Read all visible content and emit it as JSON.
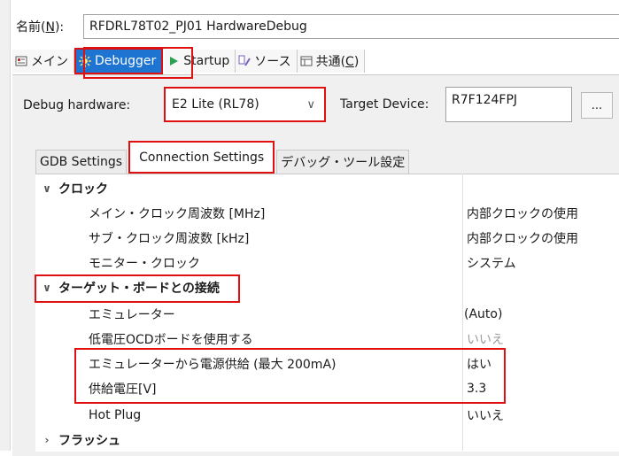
{
  "name_label": "名前(",
  "name_mnemonic": "N",
  "name_label_end": "):",
  "config_name": "RFDRL78T02_PJ01 HardwareDebug",
  "tabs": [
    {
      "label": "メイン",
      "icon": "main-icon"
    },
    {
      "label": "Debugger",
      "icon": "debugger-icon"
    },
    {
      "label": "Startup",
      "icon": "startup-icon"
    },
    {
      "label": "ソース",
      "icon": "source-icon"
    },
    {
      "label": "共通(",
      "mnemonic": "C",
      "label_end": ")",
      "icon": "common-icon"
    }
  ],
  "debug_hw_label": "Debug hardware:",
  "debug_hw_value": "E2 Lite (RL78)",
  "target_device_label": "Target Device:",
  "target_device_value": "R7F124FPJ",
  "browse_label": "...",
  "subtabs": [
    "GDB Settings",
    "Connection Settings",
    "デバッグ・ツール設定"
  ],
  "tree": {
    "clock": {
      "label": "クロック",
      "items": [
        {
          "name": "メイン・クロック周波数 [MHz]",
          "value": "内部クロックの使用"
        },
        {
          "name": "サブ・クロック周波数 [kHz]",
          "value": "内部クロックの使用"
        },
        {
          "name": "モニター・クロック",
          "value": "システム"
        }
      ]
    },
    "target": {
      "label": "ターゲット・ボードとの接続",
      "items": [
        {
          "name": "エミュレーター",
          "value": "(Auto)"
        },
        {
          "name": "低電圧OCDボードを使用する",
          "value": "いいえ"
        },
        {
          "name": "エミュレーターから電源供給 (最大 200mA)",
          "value": "はい"
        },
        {
          "name": "供給電圧[V]",
          "value": "3.3"
        },
        {
          "name": "Hot Plug",
          "value": "いいえ"
        }
      ]
    },
    "flash": {
      "label": "フラッシュ"
    }
  },
  "colors": {
    "accent": "#1e74d1",
    "highlight": "#e01010",
    "muted": "#9a9a9a"
  }
}
